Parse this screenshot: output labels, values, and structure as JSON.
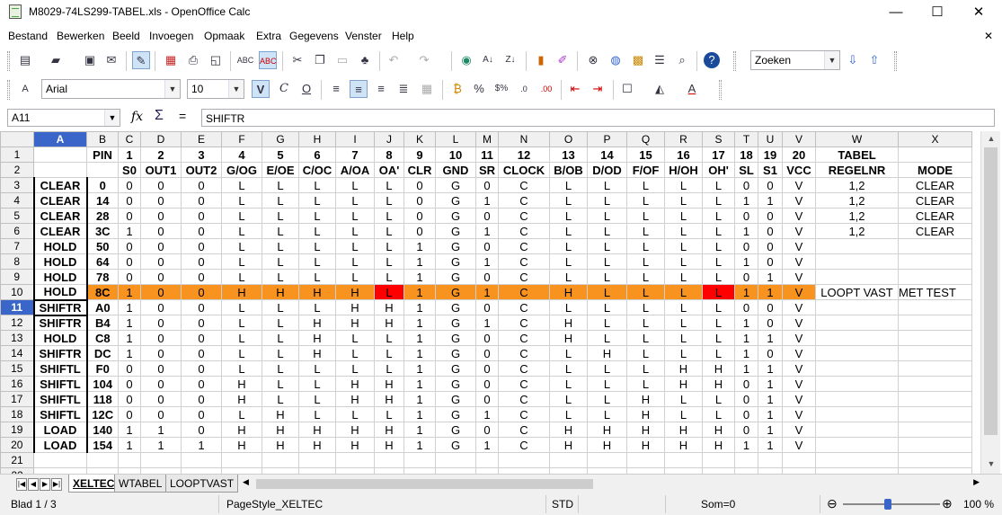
{
  "window": {
    "title": "M8029-74LS299-TABEL.xls - OpenOffice Calc",
    "minimize": "—",
    "maximize": "☐",
    "close": "✕"
  },
  "menu": [
    "Bestand",
    "Bewerken",
    "Beeld",
    "Invoegen",
    "Opmaak",
    "Extra",
    "Gegevens",
    "Venster",
    "Help"
  ],
  "close_doc": "✕",
  "toolbar1": {
    "search_placeholder": "Zoeken"
  },
  "toolbar2": {
    "font_name": "Arial",
    "font_size": "10"
  },
  "formula_bar": {
    "cell_ref": "A11",
    "content": "SHIFTR",
    "fx": "fx",
    "sum": "Σ",
    "eq": "="
  },
  "columns": [
    "A",
    "B",
    "C",
    "D",
    "E",
    "F",
    "G",
    "H",
    "I",
    "J",
    "K",
    "L",
    "M",
    "N",
    "O",
    "P",
    "Q",
    "R",
    "S",
    "T",
    "U",
    "V",
    "W",
    "X"
  ],
  "rows": [
    [
      "",
      "PIN",
      "1",
      "2",
      "3",
      "4",
      "5",
      "6",
      "7",
      "8",
      "9",
      "10",
      "11",
      "12",
      "13",
      "14",
      "15",
      "16",
      "17",
      "18",
      "19",
      "20",
      "TABEL",
      ""
    ],
    [
      "",
      "",
      "S0",
      "OUT1",
      "OUT2",
      "G/OG",
      "E/OE",
      "C/OC",
      "A/OA",
      "OA'",
      "CLR",
      "GND",
      "SR",
      "CLOCK",
      "B/OB",
      "D/OD",
      "F/OF",
      "H/OH",
      "OH'",
      "SL",
      "S1",
      "VCC",
      "REGELNR",
      "MODE"
    ],
    [
      "CLEAR",
      "0",
      "0",
      "0",
      "0",
      "L",
      "L",
      "L",
      "L",
      "L",
      "0",
      "G",
      "0",
      "C",
      "L",
      "L",
      "L",
      "L",
      "L",
      "0",
      "0",
      "V",
      "1,2",
      "CLEAR"
    ],
    [
      "CLEAR",
      "14",
      "0",
      "0",
      "0",
      "L",
      "L",
      "L",
      "L",
      "L",
      "0",
      "G",
      "1",
      "C",
      "L",
      "L",
      "L",
      "L",
      "L",
      "1",
      "1",
      "V",
      "1,2",
      "CLEAR"
    ],
    [
      "CLEAR",
      "28",
      "0",
      "0",
      "0",
      "L",
      "L",
      "L",
      "L",
      "L",
      "0",
      "G",
      "0",
      "C",
      "L",
      "L",
      "L",
      "L",
      "L",
      "0",
      "0",
      "V",
      "1,2",
      "CLEAR"
    ],
    [
      "CLEAR",
      "3C",
      "1",
      "0",
      "0",
      "L",
      "L",
      "L",
      "L",
      "L",
      "0",
      "G",
      "1",
      "C",
      "L",
      "L",
      "L",
      "L",
      "L",
      "1",
      "0",
      "V",
      "1,2",
      "CLEAR"
    ],
    [
      "HOLD",
      "50",
      "0",
      "0",
      "0",
      "L",
      "L",
      "L",
      "L",
      "L",
      "1",
      "G",
      "0",
      "C",
      "L",
      "L",
      "L",
      "L",
      "L",
      "0",
      "0",
      "V",
      "",
      ""
    ],
    [
      "HOLD",
      "64",
      "0",
      "0",
      "0",
      "L",
      "L",
      "L",
      "L",
      "L",
      "1",
      "G",
      "1",
      "C",
      "L",
      "L",
      "L",
      "L",
      "L",
      "1",
      "0",
      "V",
      "",
      ""
    ],
    [
      "HOLD",
      "78",
      "0",
      "0",
      "0",
      "L",
      "L",
      "L",
      "L",
      "L",
      "1",
      "G",
      "0",
      "C",
      "L",
      "L",
      "L",
      "L",
      "L",
      "0",
      "1",
      "V",
      "",
      ""
    ],
    [
      "HOLD",
      "8C",
      "1",
      "0",
      "0",
      "H",
      "H",
      "H",
      "H",
      "L",
      "1",
      "G",
      "1",
      "C",
      "H",
      "L",
      "L",
      "L",
      "L",
      "1",
      "1",
      "V",
      "LOOPT VAST",
      "MET TEST"
    ],
    [
      "SHIFTR",
      "A0",
      "1",
      "0",
      "0",
      "L",
      "L",
      "L",
      "H",
      "H",
      "1",
      "G",
      "0",
      "C",
      "L",
      "L",
      "L",
      "L",
      "L",
      "0",
      "0",
      "V",
      "",
      ""
    ],
    [
      "SHIFTR",
      "B4",
      "1",
      "0",
      "0",
      "L",
      "L",
      "H",
      "H",
      "H",
      "1",
      "G",
      "1",
      "C",
      "H",
      "L",
      "L",
      "L",
      "L",
      "1",
      "0",
      "V",
      "",
      ""
    ],
    [
      "HOLD",
      "C8",
      "1",
      "0",
      "0",
      "L",
      "L",
      "H",
      "L",
      "L",
      "1",
      "G",
      "0",
      "C",
      "H",
      "L",
      "L",
      "L",
      "L",
      "1",
      "1",
      "V",
      "",
      ""
    ],
    [
      "SHIFTR",
      "DC",
      "1",
      "0",
      "0",
      "L",
      "L",
      "H",
      "L",
      "L",
      "1",
      "G",
      "0",
      "C",
      "L",
      "H",
      "L",
      "L",
      "L",
      "1",
      "0",
      "V",
      "",
      ""
    ],
    [
      "SHIFTL",
      "F0",
      "0",
      "0",
      "0",
      "L",
      "L",
      "L",
      "L",
      "L",
      "1",
      "G",
      "0",
      "C",
      "L",
      "L",
      "L",
      "H",
      "H",
      "1",
      "1",
      "V",
      "",
      ""
    ],
    [
      "SHIFTL",
      "104",
      "0",
      "0",
      "0",
      "H",
      "L",
      "L",
      "H",
      "H",
      "1",
      "G",
      "0",
      "C",
      "L",
      "L",
      "L",
      "H",
      "H",
      "0",
      "1",
      "V",
      "",
      ""
    ],
    [
      "SHIFTL",
      "118",
      "0",
      "0",
      "0",
      "H",
      "L",
      "L",
      "H",
      "H",
      "1",
      "G",
      "0",
      "C",
      "L",
      "L",
      "H",
      "L",
      "L",
      "0",
      "1",
      "V",
      "",
      ""
    ],
    [
      "SHIFTL",
      "12C",
      "0",
      "0",
      "0",
      "L",
      "H",
      "L",
      "L",
      "L",
      "1",
      "G",
      "1",
      "C",
      "L",
      "L",
      "H",
      "L",
      "L",
      "0",
      "1",
      "V",
      "",
      ""
    ],
    [
      "LOAD",
      "140",
      "1",
      "1",
      "0",
      "H",
      "H",
      "H",
      "H",
      "H",
      "1",
      "G",
      "0",
      "C",
      "H",
      "H",
      "H",
      "H",
      "H",
      "0",
      "1",
      "V",
      "",
      ""
    ],
    [
      "LOAD",
      "154",
      "1",
      "1",
      "1",
      "H",
      "H",
      "H",
      "H",
      "H",
      "1",
      "G",
      "1",
      "C",
      "H",
      "H",
      "H",
      "H",
      "H",
      "1",
      "1",
      "V",
      "",
      ""
    ],
    [
      "",
      "",
      "",
      "",
      "",
      "",
      "",
      "",
      "",
      "",
      "",
      "",
      "",
      "",
      "",
      "",
      "",
      "",
      "",
      "",
      "",
      "",
      "",
      ""
    ],
    [
      "",
      "",
      "",
      "",
      "",
      "",
      "",
      "",
      "",
      "",
      "",
      "",
      "",
      "",
      "",
      "",
      "",
      "",
      "",
      "",
      "",
      "",
      "",
      ""
    ]
  ],
  "highlight": {
    "orange": "#f7931e",
    "red": "#ff0000",
    "selection": "#3a66c9"
  },
  "sheets": [
    "XELTEC",
    "WTABEL",
    "LOOPTVAST"
  ],
  "active_sheet": "XELTEC",
  "status": {
    "sheet": "Blad 1 / 3",
    "page_style": "PageStyle_XELTEC",
    "mode": "STD",
    "sum": "Som=0",
    "zoom": "100 %"
  }
}
